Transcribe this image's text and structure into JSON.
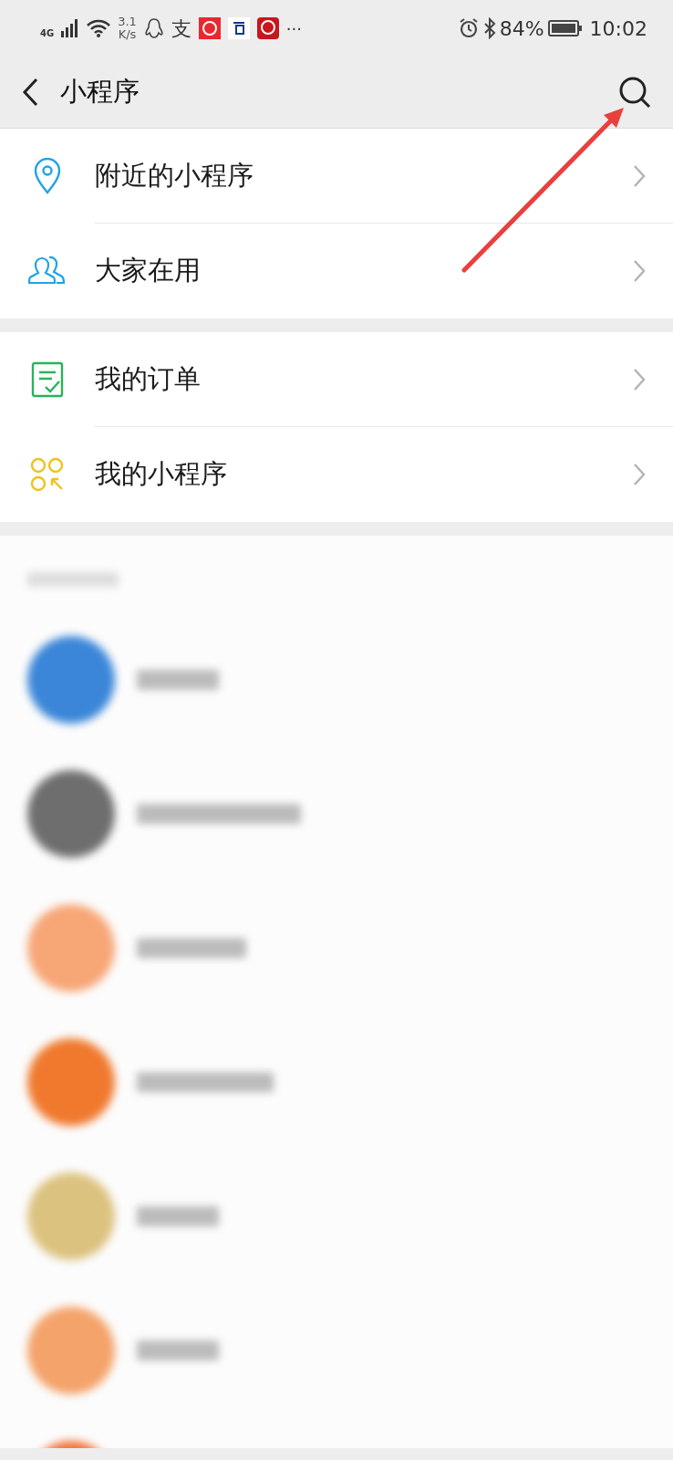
{
  "status_bar": {
    "network": "4G",
    "speed": [
      "3.1",
      "K/s"
    ],
    "app_glyph": "支",
    "more": "···",
    "battery": "84%",
    "time": "10:02"
  },
  "header": {
    "title": "小程序"
  },
  "sections": [
    {
      "items": [
        {
          "kind": "location",
          "label": "附近的小程序"
        },
        {
          "kind": "people",
          "label": "大家在用"
        }
      ]
    },
    {
      "items": [
        {
          "kind": "order",
          "label": "我的订单"
        },
        {
          "kind": "apps",
          "label": "我的小程序"
        }
      ]
    }
  ],
  "recent": {
    "items": [
      {
        "color": "#3b86d8"
      },
      {
        "color": "#6e6e6e"
      },
      {
        "color": "#f7a676"
      },
      {
        "color": "#f0792e"
      },
      {
        "color": "#dcc27f"
      },
      {
        "color": "#f4a36a"
      },
      {
        "color": "#f2743a"
      }
    ]
  }
}
